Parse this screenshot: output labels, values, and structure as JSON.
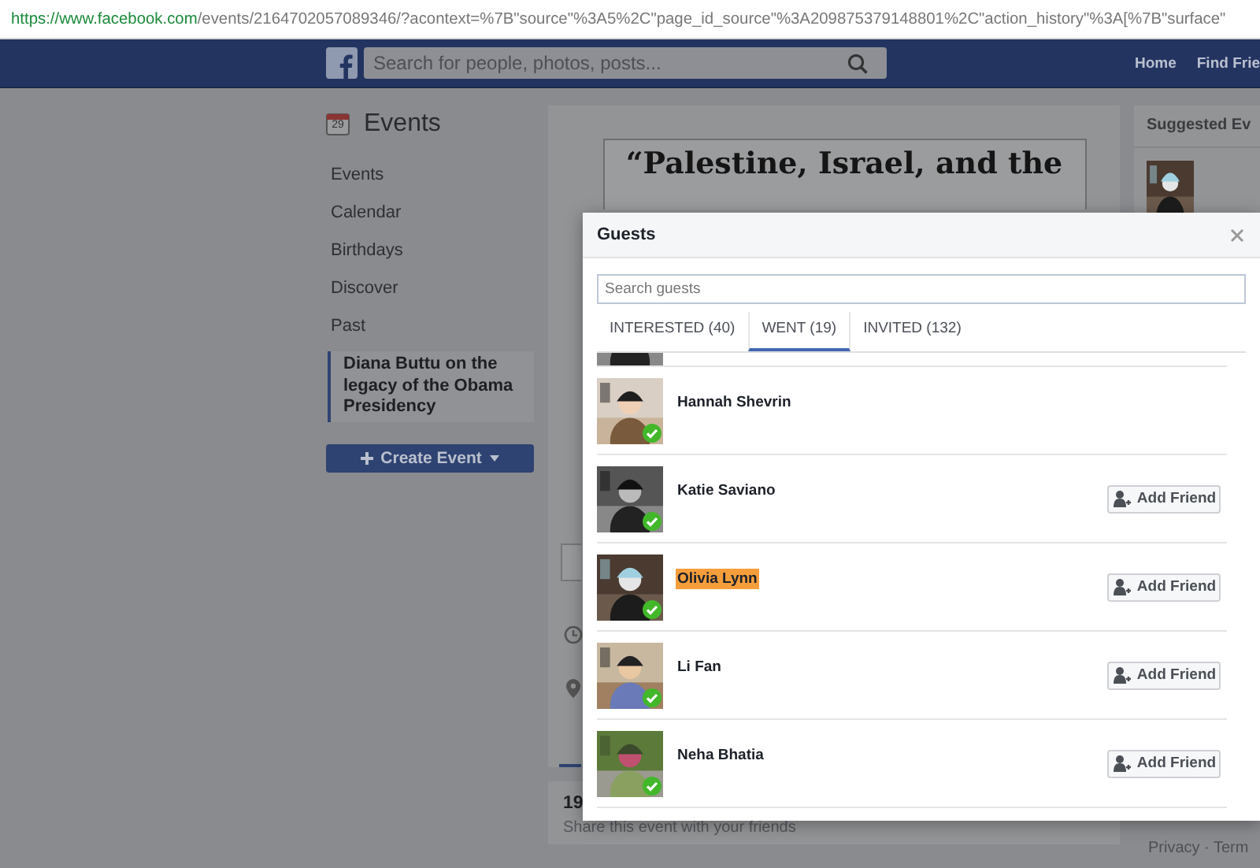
{
  "browser": {
    "url_host": "https://www.facebook.com",
    "url_path": "/events/2164702057089346/?acontext=%7B\"source\"%3A5%2C\"page_id_source\"%3A209875379148801%2C\"action_history\"%3A[%7B\"surface\""
  },
  "navbar": {
    "search_placeholder": "Search for people, photos, posts...",
    "links": [
      "Home",
      "Find Frie"
    ]
  },
  "sidebar": {
    "title": "Events",
    "calendar_day": "29",
    "items": [
      {
        "label": "Events",
        "selected": false
      },
      {
        "label": "Calendar",
        "selected": false
      },
      {
        "label": "Birthdays",
        "selected": false
      },
      {
        "label": "Discover",
        "selected": false
      },
      {
        "label": "Past",
        "selected": false
      },
      {
        "label": "Diana Buttu on the legacy of the Obama Presidency",
        "selected": true
      }
    ],
    "create_button": "Create Event"
  },
  "event": {
    "poster_lines": [
      "“Palestine, Israel, and the"
    ],
    "going_count": "19",
    "share_text": "Share this event with your friends"
  },
  "right_column": {
    "title": "Suggested Ev",
    "footer": "Privacy · Term"
  },
  "dialog": {
    "title": "Guests",
    "search_placeholder": "Search guests",
    "tabs": [
      {
        "label": "INTERESTED (40)",
        "selected": false
      },
      {
        "label": "WENT (19)",
        "selected": true
      },
      {
        "label": "INVITED (132)",
        "selected": false
      }
    ],
    "guests": [
      {
        "name": "Hannah Shevrin",
        "went": true,
        "highlighted": false
      },
      {
        "name": "Katie Saviano",
        "went": true,
        "highlighted": false,
        "add_friend": "Add Friend"
      },
      {
        "name": "Olivia Lynn",
        "went": true,
        "highlighted": true,
        "add_friend": "Add Friend"
      },
      {
        "name": "Li Fan",
        "went": true,
        "highlighted": false,
        "add_friend": "Add Friend"
      },
      {
        "name": "Neha Bhatia",
        "went": true,
        "highlighted": false,
        "add_friend": "Add Friend"
      }
    ]
  }
}
